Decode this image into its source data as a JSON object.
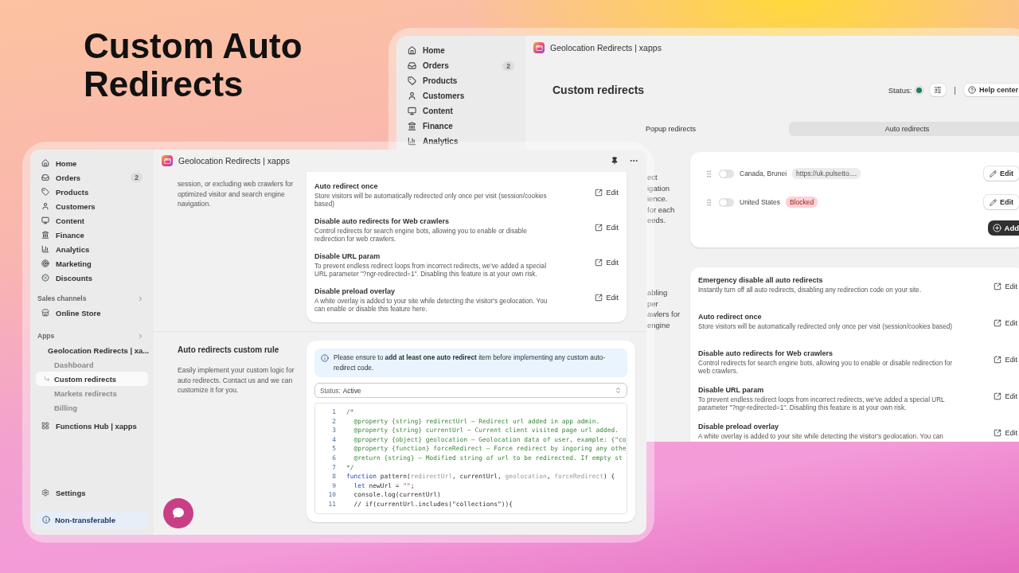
{
  "headline": "Custom Auto Redirects",
  "back_window": {
    "sidebar": [
      {
        "label": "Home"
      },
      {
        "label": "Orders",
        "badge": "2"
      },
      {
        "label": "Products"
      },
      {
        "label": "Customers"
      },
      {
        "label": "Content"
      },
      {
        "label": "Finance"
      },
      {
        "label": "Analytics"
      }
    ],
    "app_title": "Geolocation Redirects | xapps",
    "page_title": "Custom redirects",
    "status_label": "Status:",
    "status_on": true,
    "separator": "|",
    "help_label": "Help center",
    "tabs": [
      {
        "label": "Popup redirects",
        "selected": false
      },
      {
        "label": "Auto redirects",
        "selected": true
      }
    ],
    "side_text_1": [
      "ect",
      "igation",
      "ience.",
      "for each",
      "eeds."
    ],
    "redirects": [
      {
        "country": "Canada, Brunei",
        "enabled": false,
        "kind": "url",
        "tag": "https://uk.pulsetto....",
        "action": "Edit"
      },
      {
        "country": "United States",
        "enabled": false,
        "kind": "blocked",
        "tag": "Blocked",
        "action": "Edit"
      }
    ],
    "add_label": "Add",
    "side_text_2": [
      "abling",
      "per",
      "awlers for",
      "engine"
    ],
    "settings": [
      {
        "title": "Emergency disable all auto redirects",
        "description": "Instantly turn off all auto redirects, disabling any redirection code on your site.",
        "action": "Edit"
      },
      {
        "title": "Auto redirect once",
        "description": "Store visitors will be automatically redirected only once per visit (session/cookies based)",
        "action": "Edit"
      },
      {
        "title": "Disable auto redirects for Web crawlers",
        "description": "Control redirects for search engine bots, allowing you to enable or disable redirection for web crawlers.",
        "action": "Edit"
      },
      {
        "title": "Disable URL param",
        "description": "To prevent endless redirect loops from incorrect redirects, we've added a special URL parameter \"?ngr-redirected=1\". Disabling this feature is at your own risk.",
        "action": "Edit"
      },
      {
        "title": "Disable preload overlay",
        "description": "A white overlay is added to your site while detecting the visitor's geolocation. You can",
        "action": "Edit"
      }
    ]
  },
  "front_window": {
    "nav": [
      {
        "label": "Home"
      },
      {
        "label": "Orders",
        "badge": "2"
      },
      {
        "label": "Products"
      },
      {
        "label": "Customers"
      },
      {
        "label": "Content"
      },
      {
        "label": "Finance"
      },
      {
        "label": "Analytics"
      },
      {
        "label": "Marketing"
      },
      {
        "label": "Discounts"
      }
    ],
    "sales_channels": {
      "heading": "Sales channels",
      "items": [
        {
          "label": "Online Store"
        }
      ]
    },
    "apps": {
      "heading": "Apps",
      "items": [
        {
          "label": "Geolocation Redirects | xa...",
          "children": [
            {
              "label": "Dashboard",
              "selected": false
            },
            {
              "label": "Custom redirects",
              "selected": true
            },
            {
              "label": "Markets redirects",
              "selected": false
            },
            {
              "label": "Billing",
              "selected": false
            }
          ]
        },
        {
          "label": "Functions Hub | xapps"
        }
      ]
    },
    "settings_label": "Settings",
    "plan_label": "Non-transferable",
    "app_title": "Geolocation Redirects | xapps",
    "intro_text": "session, or excluding web crawlers for optimized visitor and search engine navigation.",
    "settings": [
      {
        "title": "Auto redirect once",
        "description": "Store visitors will be automatically redirected only once per visit (session/cookies based)",
        "action": "Edit"
      },
      {
        "title": "Disable auto redirects for Web crawlers",
        "description": "Control redirects for search engine bots, allowing you to enable or disable redirection for web crawlers.",
        "action": "Edit"
      },
      {
        "title": "Disable URL param",
        "description": "To prevent endless redirect loops from incorrect redirects, we've added a special URL parameter \"?ngr-redirected=1\". Disabling this feature is at your own risk.",
        "action": "Edit"
      },
      {
        "title": "Disable preload overlay",
        "description": "A white overlay is added to your site while detecting the visitor's geolocation. You can enable or disable this feature here.",
        "action": "Edit"
      }
    ],
    "custom_rule": {
      "title": "Auto redirects custom rule",
      "description": "Easily implement your custom logic for auto redirects. Contact us and we can customize it for you.",
      "notice": "Please ensure to **add at least one auto redirect** item before implementing any custom auto-redirect code.",
      "status_label": "Status:",
      "status_value": "Active",
      "code": [
        {
          "number": "1",
          "tokens": [
            {
              "kind": "comment",
              "text": "/*"
            }
          ]
        },
        {
          "number": "2",
          "tokens": [
            {
              "kind": "comment",
              "text": "  @property {string} redirectUrl – Redirect url added in app admin."
            }
          ]
        },
        {
          "number": "3",
          "tokens": [
            {
              "kind": "comment",
              "text": "  @property {string} currentUrl – Current client visited page url added."
            }
          ]
        },
        {
          "number": "4",
          "tokens": [
            {
              "kind": "comment",
              "text": "  @property {object} geolocation – Geolocation data of user, example: {\"co"
            }
          ]
        },
        {
          "number": "5",
          "tokens": [
            {
              "kind": "comment",
              "text": "  @property {function} forceRedirect – Force redirect by ingoring any othe"
            }
          ]
        },
        {
          "number": "6",
          "tokens": [
            {
              "kind": "comment",
              "text": "  @return {string} – Modified string of url to be redirected. If empty st"
            }
          ]
        },
        {
          "number": "7",
          "tokens": [
            {
              "kind": "comment",
              "text": "*/"
            }
          ]
        },
        {
          "number": "8",
          "tokens": [
            {
              "kind": "keyword",
              "text": "function"
            },
            {
              "kind": "plain",
              "text": " pattern("
            },
            {
              "kind": "param",
              "text": "redirectUrl"
            },
            {
              "kind": "plain",
              "text": ", currentUrl, "
            },
            {
              "kind": "param",
              "text": "geolocation"
            },
            {
              "kind": "plain",
              "text": ", "
            },
            {
              "kind": "param",
              "text": "forceRedirect"
            },
            {
              "kind": "plain",
              "text": ") {"
            }
          ]
        },
        {
          "number": "9",
          "tokens": [
            {
              "kind": "keyword",
              "text": "  let"
            },
            {
              "kind": "plain",
              "text": " newUrl = "
            },
            {
              "kind": "string",
              "text": "\"\""
            },
            {
              "kind": "plain",
              "text": ";"
            }
          ]
        },
        {
          "number": "10",
          "tokens": [
            {
              "kind": "plain",
              "text": "  console.log(currentUrl)"
            }
          ]
        },
        {
          "number": "11",
          "tokens": [
            {
              "kind": "plain",
              "text": "  // if(currentUrl.includes(\"collections\")){"
            }
          ]
        }
      ]
    }
  }
}
